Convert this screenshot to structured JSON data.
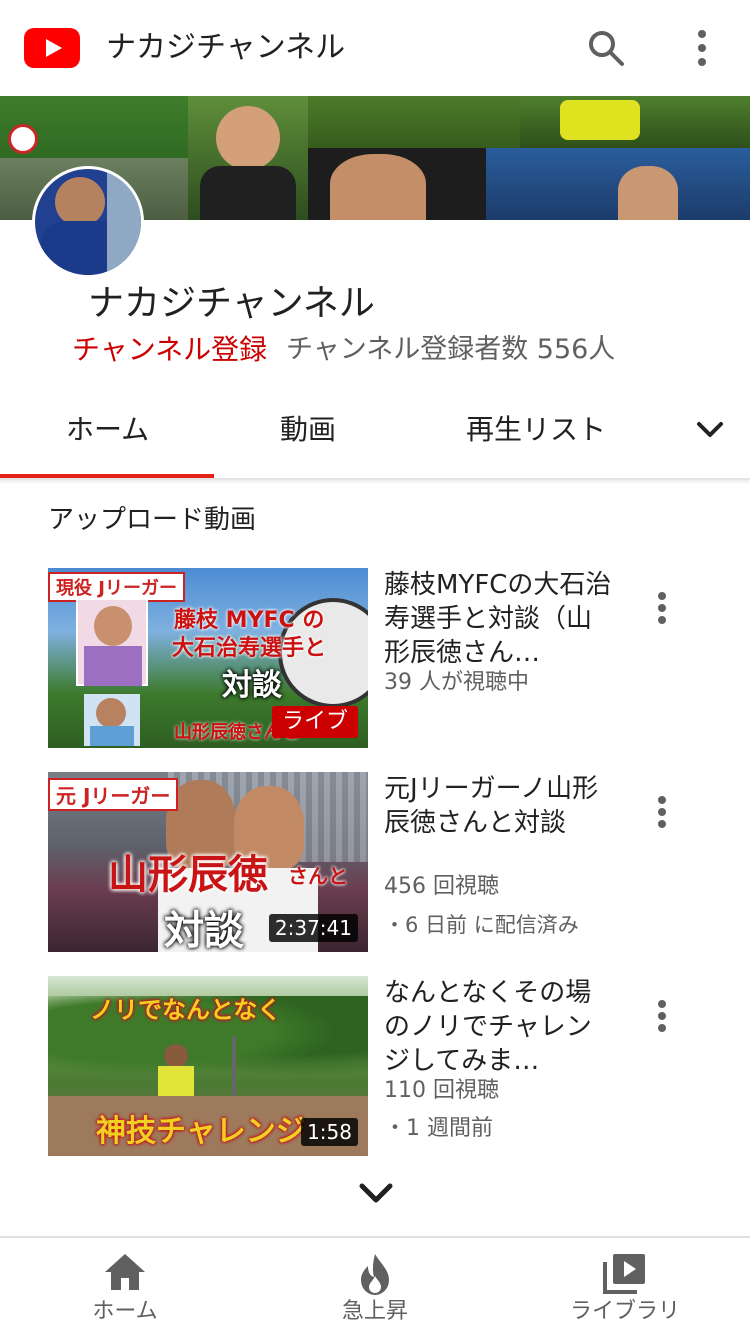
{
  "header": {
    "title": "ナカジチャンネル",
    "logo_icon": "youtube-logo",
    "search_icon": "search-icon",
    "more_icon": "more-vert-icon"
  },
  "channel": {
    "name": "ナカジチャンネル",
    "subscribe_label": "チャンネル登録",
    "subscriber_count": "チャンネル登録者数 556人"
  },
  "tabs": [
    {
      "label": "ホーム",
      "selected": true
    },
    {
      "label": "動画",
      "selected": false
    },
    {
      "label": "再生リスト",
      "selected": false
    }
  ],
  "section": {
    "title": "アップロード動画"
  },
  "videos": [
    {
      "title": "藤枝MYFCの大石治寿選手と対談（山形辰徳さん…",
      "meta1": "39 人が視聴中",
      "meta2": "",
      "badge": "ライブ",
      "thumb_text": {
        "tag": "現役 Jリーガー",
        "line1": "藤枝 MYFC の",
        "line2": "大石治寿選手と",
        "line3": "対談",
        "line4": "山形辰徳さんと"
      }
    },
    {
      "title": "元Jリーガーノ山形辰徳さんと対談",
      "meta1": "456 回視聴",
      "meta2": "・6 日前 に配信済み",
      "badge": "2:37:41",
      "thumb_text": {
        "tag": "元 Jリーガー",
        "line1": "山形辰徳",
        "line1b": "さんと",
        "line2": "対談"
      }
    },
    {
      "title": "なんとなくその場のノリでチャレンジしてみま…",
      "meta1": "110 回視聴",
      "meta2": "・1 週間前",
      "badge": "1:58",
      "thumb_text": {
        "line1": "ノリでなんとなく",
        "line2": "神技チャレンジ"
      }
    }
  ],
  "bottom_nav": [
    {
      "label": "ホーム",
      "icon": "home-icon"
    },
    {
      "label": "急上昇",
      "icon": "trending-icon"
    },
    {
      "label": "ライブラリ",
      "icon": "library-icon"
    }
  ],
  "colors": {
    "brand_red": "#ff0000",
    "subscribe_red": "#cc0000",
    "tab_indicator": "#e62117",
    "secondary_text": "#606060"
  }
}
